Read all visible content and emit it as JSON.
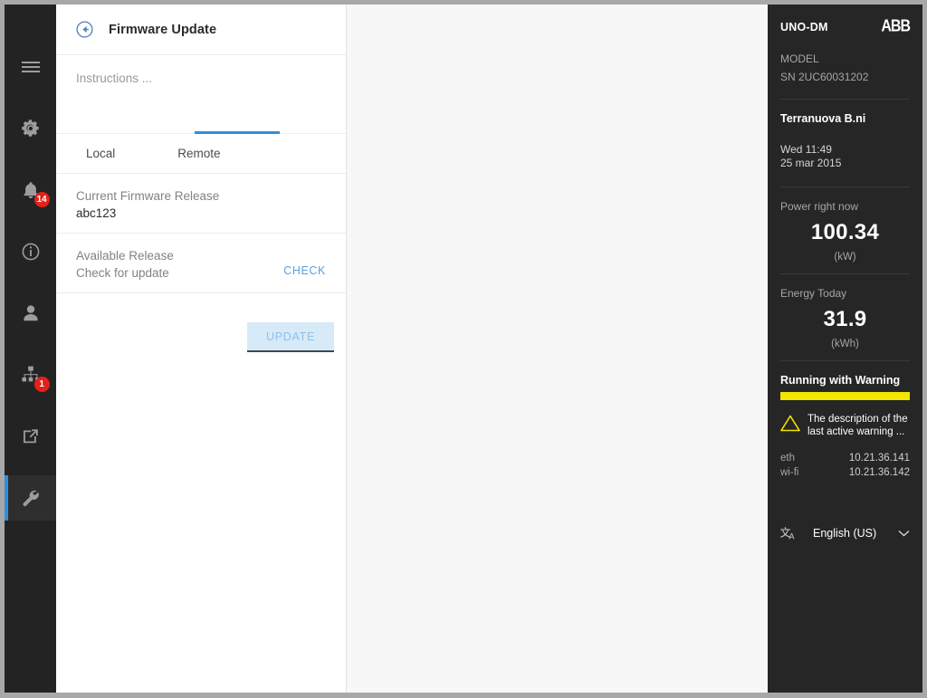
{
  "sidebar": {
    "items": [
      {
        "name": "menu",
        "icon": "hamburger-menu-icon",
        "badge": null
      },
      {
        "name": "settings",
        "icon": "gear-icon",
        "badge": null
      },
      {
        "name": "notifications",
        "icon": "bell-icon",
        "badge": "14"
      },
      {
        "name": "information",
        "icon": "info-circle-icon",
        "badge": null
      },
      {
        "name": "account",
        "icon": "user-icon",
        "badge": null
      },
      {
        "name": "network",
        "icon": "sitemap-icon",
        "badge": "1"
      },
      {
        "name": "export",
        "icon": "external-link-icon",
        "badge": null
      },
      {
        "name": "tools",
        "icon": "wrench-icon",
        "badge": null
      }
    ],
    "active_index": 7
  },
  "panel": {
    "back_icon": "arrow-circle-left-icon",
    "title": "Firmware Update",
    "instructions": "Instructions ...",
    "tabs": [
      {
        "label": "Local",
        "active": false
      },
      {
        "label": "Remote",
        "active": true
      }
    ],
    "rows": [
      {
        "label": "Current Firmware Release",
        "value": "abc123",
        "muted": false,
        "action": null
      },
      {
        "label": "Available Release",
        "value": "Check  for update",
        "muted": true,
        "action": "CHECK"
      }
    ],
    "update_label": "UPDATE"
  },
  "rightbar": {
    "device": "UNO-DM",
    "brand": "ABB",
    "model_label": "MODEL",
    "serial": "SN 2UC60031202",
    "plant": "Terranuova B.ni",
    "time": "Wed 11:49",
    "date": "25 mar 2015",
    "metrics": [
      {
        "label": "Power right now",
        "value": "100.34",
        "unit": "(kW)"
      },
      {
        "label": "Energy Today",
        "value": "31.9",
        "unit": "(kWh)"
      }
    ],
    "status": {
      "text": "Running with Warning",
      "bar_color": "#f2e500",
      "warning_icon": "warning-triangle-icon",
      "warning_text": "The description of the last active warning ..."
    },
    "networks": [
      {
        "name": "eth",
        "ip": "10.21.36.141"
      },
      {
        "name": "wi-fi",
        "ip": "10.21.36.142"
      }
    ],
    "language": {
      "icon": "translate-icon",
      "label": "English (US)",
      "chevron": "chevron-down-icon"
    }
  },
  "colors": {
    "accent": "#2f8fd8",
    "link": "#5aa0e0",
    "badge": "#e32119",
    "warning": "#f2e500",
    "sidebar_bg": "#232323",
    "rightbar_bg": "#262626"
  }
}
